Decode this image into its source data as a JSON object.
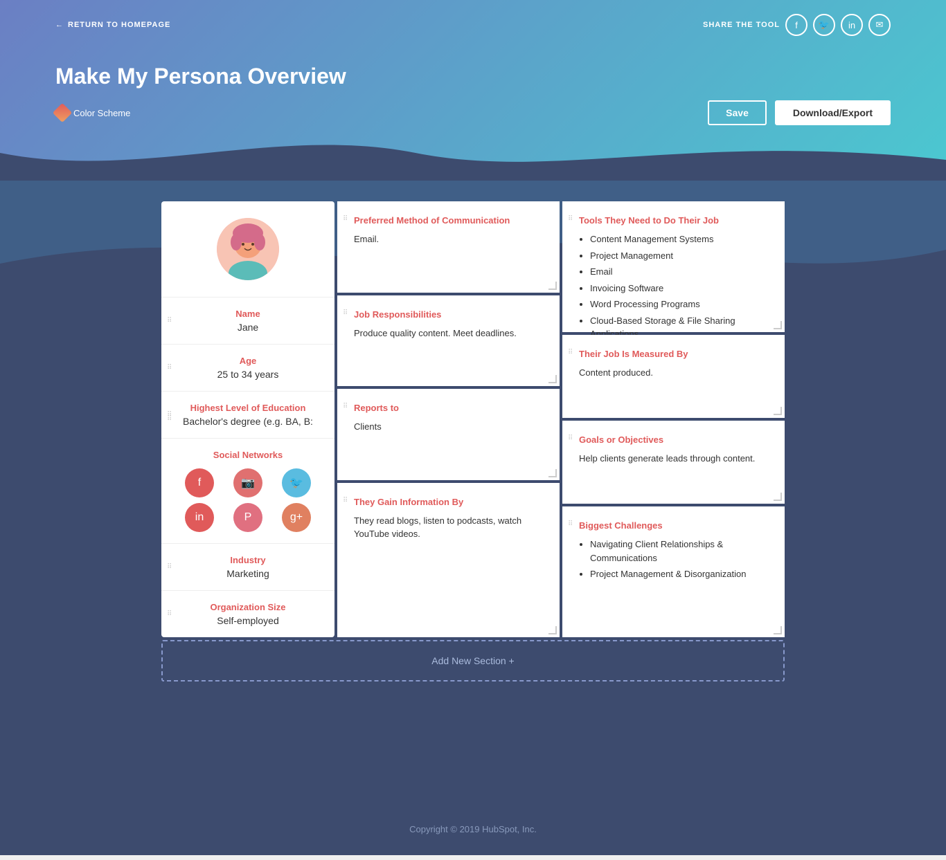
{
  "header": {
    "return_label": "RETURN TO HOMEPAGE",
    "share_label": "SHARE THE TOOL",
    "title": "Make My Persona Overview",
    "color_scheme_label": "Color Scheme",
    "save_button": "Save",
    "download_button": "Download/Export"
  },
  "left_column": {
    "name_label": "Name",
    "name_value": "Jane",
    "age_label": "Age",
    "age_value": "25 to 34 years",
    "education_label": "Highest Level of Education",
    "education_value": "Bachelor's degree (e.g. BA, B:",
    "social_label": "Social Networks",
    "social_icons": [
      "f",
      "♡",
      "🐦",
      "in",
      "P",
      "g+"
    ],
    "industry_label": "Industry",
    "industry_value": "Marketing",
    "org_size_label": "Organization Size",
    "org_size_value": "Self-employed"
  },
  "cards": {
    "comm_label": "Preferred Method of Communication",
    "comm_value": "Email.",
    "job_resp_label": "Job Responsibilities",
    "job_resp_value": "Produce quality content. Meet deadlines.",
    "reports_to_label": "Reports to",
    "reports_to_value": "Clients",
    "tools_label": "Tools They Need to Do Their Job",
    "tools_items": [
      "Content Management Systems",
      "Project Management",
      "Email",
      "Invoicing Software",
      "Word Processing Programs",
      "Cloud-Based Storage & File Sharing Applications"
    ],
    "measured_label": "Their Job Is Measured By",
    "measured_value": "Content produced.",
    "info_label": "They Gain Information By",
    "info_value": "They read blogs, listen to podcasts, watch YouTube videos.",
    "goals_label": "Goals or Objectives",
    "goals_value": "Help clients generate leads through content.",
    "challenges_label": "Biggest Challenges",
    "challenges_items": [
      "Navigating Client Relationships & Communications",
      "Project Management & Disorganization"
    ]
  },
  "add_section_label": "Add New Section +",
  "copyright": "Copyright © 2019 HubSpot, Inc."
}
